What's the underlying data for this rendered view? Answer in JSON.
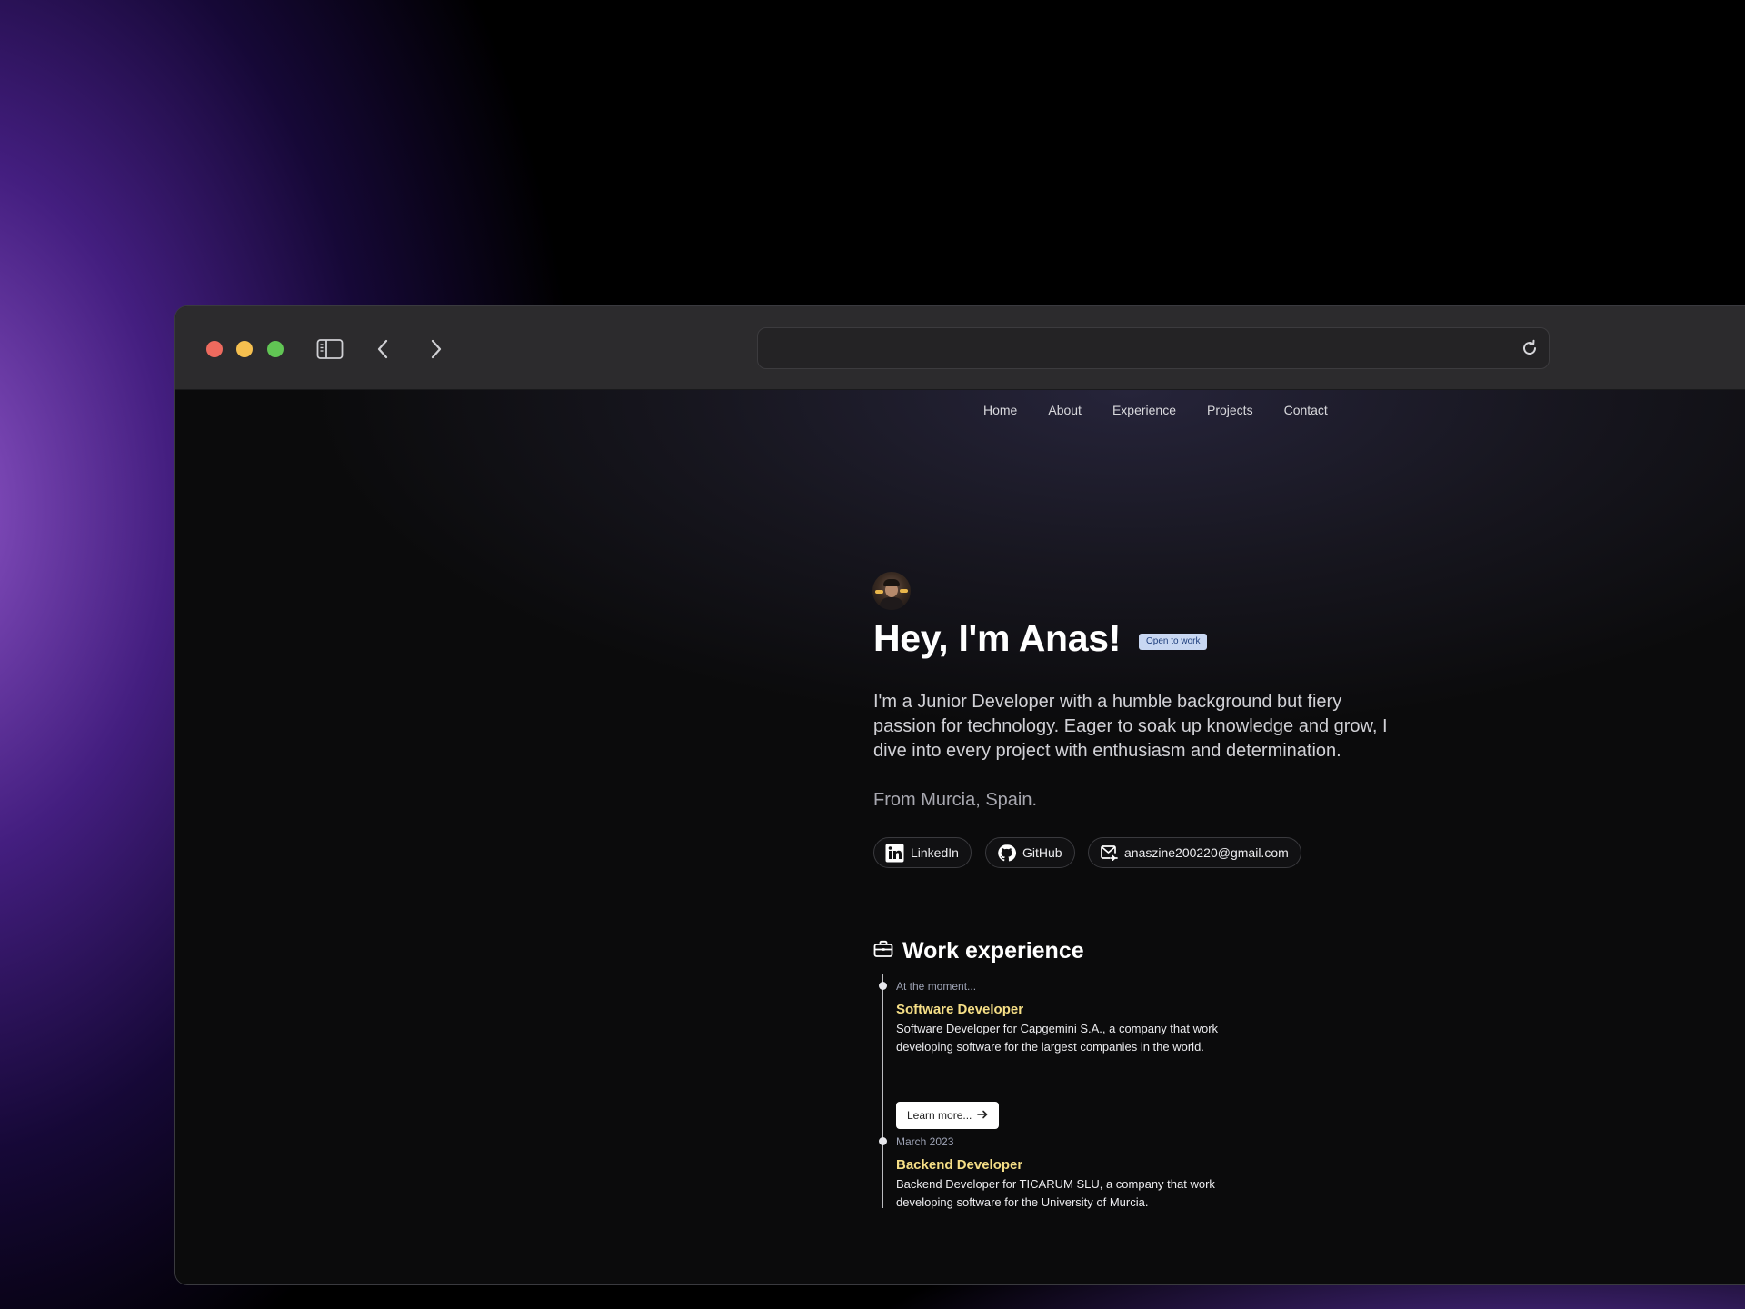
{
  "browser": {
    "address_value": "",
    "icons": [
      "sidebar-toggle-icon",
      "back-arrow-icon",
      "forward-arrow-icon",
      "reload-icon"
    ],
    "traffic_light_colors": [
      "#ed6a5e",
      "#f5bf4f",
      "#61c554"
    ]
  },
  "nav": {
    "items": [
      {
        "label": "Home"
      },
      {
        "label": "About"
      },
      {
        "label": "Experience"
      },
      {
        "label": "Projects"
      },
      {
        "label": "Contact"
      }
    ]
  },
  "hero": {
    "title": "Hey, I'm Anas!",
    "badge": "Open to work",
    "intro": "I'm a Junior Developer with a humble background but fiery passion for technology. Eager to soak up knowledge and grow, I dive into every project with enthusiasm and determination.",
    "location": "From Murcia, Spain."
  },
  "links": [
    {
      "label": "LinkedIn",
      "icon": "linkedin-icon"
    },
    {
      "label": "GitHub",
      "icon": "github-icon"
    },
    {
      "label": "anaszine200220@gmail.com",
      "icon": "mail-icon"
    }
  ],
  "experience": {
    "title": "Work experience",
    "icon": "briefcase-icon",
    "items": [
      {
        "date": "At the moment...",
        "role": "Software Developer",
        "description": "Software Developer for Capgemini S.A., a company that work developing software for the largest companies in the world.",
        "button": "Learn more..."
      },
      {
        "date": "March 2023",
        "role": "Backend Developer",
        "description": "Backend Developer for TICARUM SLU, a company that work developing software for the University of Murcia."
      }
    ]
  },
  "colors": {
    "role_accent": "#f5de86",
    "badge_bg": "#c8d7f2",
    "badge_text": "#1f3f7d"
  }
}
